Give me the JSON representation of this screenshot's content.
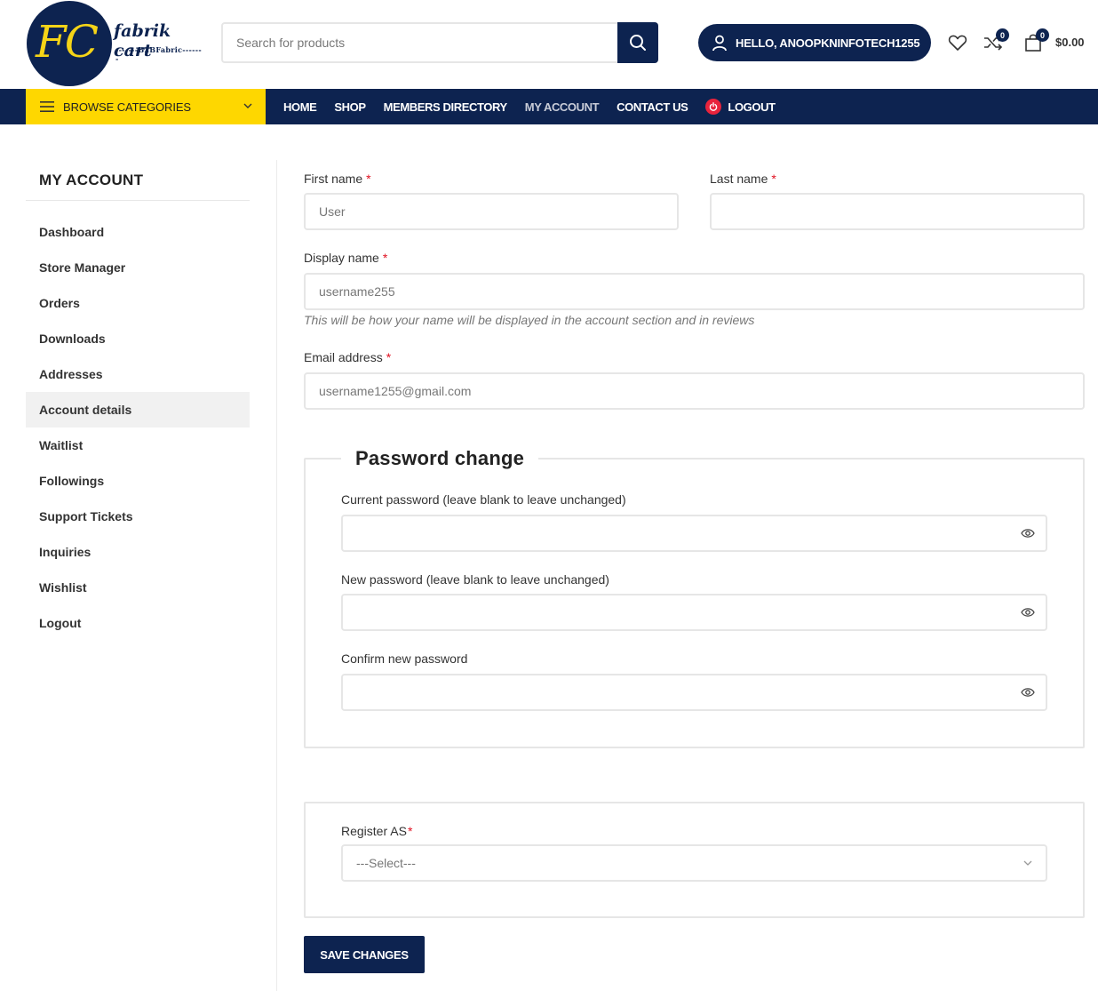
{
  "brand": {
    "logo_initials": "FC",
    "logo_name": "fabrik cart",
    "logo_tagline": "-------B2BFabric-------",
    "primary_color": "#0d2350",
    "accent_color": "#fed700"
  },
  "header": {
    "search_placeholder": "Search for products",
    "hello_label": "HELLO, ANOOPKNINFOTECH1255",
    "compare_count": "0",
    "cart_count": "0",
    "cart_total": "$0.00",
    "icons": [
      "user-icon",
      "heart-icon",
      "shuffle-icon",
      "shopping-bag-icon",
      "search-icon"
    ]
  },
  "nav": {
    "browse_label": "BROWSE CATEGORIES",
    "links": [
      "HOME",
      "SHOP",
      "MEMBERS DIRECTORY",
      "MY ACCOUNT",
      "CONTACT US",
      "LOGOUT"
    ],
    "active": "MY ACCOUNT"
  },
  "sidebar": {
    "title": "MY ACCOUNT",
    "items": [
      "Dashboard",
      "Store Manager",
      "Orders",
      "Downloads",
      "Addresses",
      "Account details",
      "Waitlist",
      "Followings",
      "Support Tickets",
      "Inquiries",
      "Wishlist",
      "Logout"
    ],
    "active": "Account details"
  },
  "form": {
    "first_name_label": "First name",
    "first_name_value": "User",
    "last_name_label": "Last name",
    "last_name_value": "",
    "display_name_label": "Display name",
    "display_name_value": "username255",
    "display_name_hint": "This will be how your name will be displayed in the account section and in reviews",
    "email_label": "Email address",
    "email_value": "username1255@gmail.com",
    "required_mark": "*"
  },
  "password": {
    "legend": "Password change",
    "current_label": "Current password (leave blank to leave unchanged)",
    "new_label": "New password (leave blank to leave unchanged)",
    "confirm_label": "Confirm new password"
  },
  "register": {
    "label": "Register AS",
    "selected": "---Select---"
  },
  "actions": {
    "save_label": "SAVE CHANGES"
  }
}
